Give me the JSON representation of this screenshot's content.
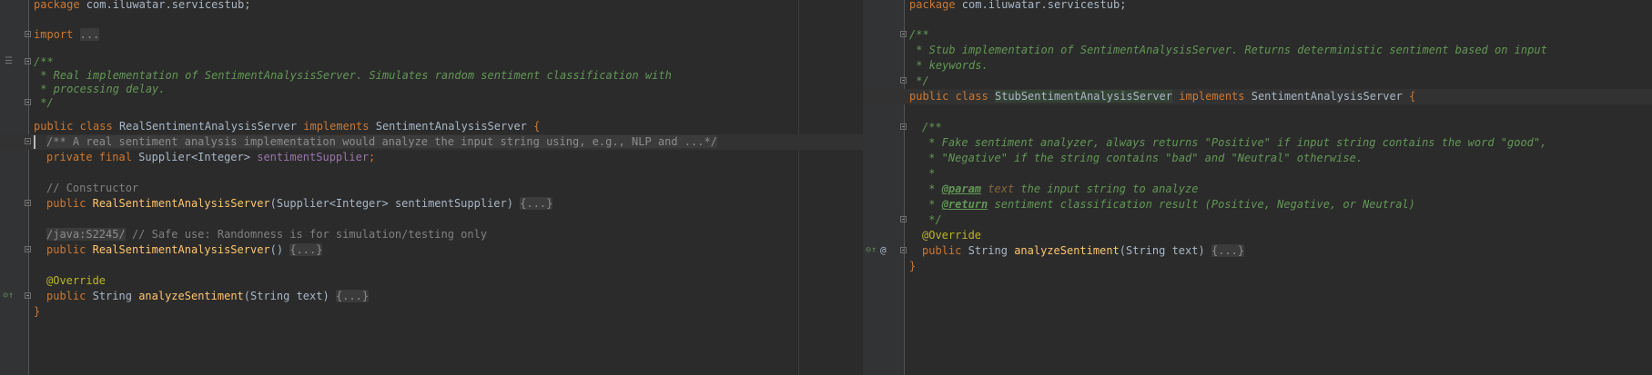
{
  "left_editor": {
    "package_kw": "package",
    "package_name": " com.iluwatar.servicestub;",
    "import_kw": "import",
    "import_folded": "...",
    "javadoc": [
      "/**",
      " * Real implementation of SentimentAnalysisServer. Simulates random sentiment classification with",
      " * processing delay.",
      " */"
    ],
    "class_modifiers": "public class",
    "class_name": "RealSentimentAnalysisServer",
    "implements_kw": "implements",
    "interface_name": "SentimentAnalysisServer",
    "open_brace": "{",
    "folded_comment": "/** A real sentiment analysis implementation would analyze the input string using, e.g., NLP and ...*/",
    "field_modifiers": "private final",
    "field_type": "Supplier<Integer>",
    "field_name": "sentimentSupplier",
    "field_end": ";",
    "ctor_comment": "// Constructor",
    "public_kw": "public",
    "ctor1_name": "RealSentimentAnalysisServer",
    "ctor1_params": "(Supplier<Integer> sentimentSupplier)",
    "folded_body": "{...}",
    "suppress_tag": "/java:S2245/",
    "suppress_comment": "// Safe use: Randomness is for simulation/testing only",
    "ctor2_name": "RealSentimentAnalysisServer",
    "ctor2_params": "()",
    "override_annotation": "@Override",
    "method_return": "String",
    "method_name": "analyzeSentiment",
    "method_params": "(String text)",
    "close_brace": "}"
  },
  "right_editor": {
    "package_kw": "package",
    "package_name": " com.iluwatar.servicestub;",
    "class_javadoc": [
      "/**",
      " * Stub implementation of SentimentAnalysisServer. Returns deterministic sentiment based on input",
      " * keywords.",
      " */"
    ],
    "class_modifiers": "public class",
    "class_name": "StubSentimentAnalysisServer",
    "implements_kw": "implements",
    "interface_name": "SentimentAnalysisServer",
    "open_brace": "{",
    "method_javadoc": [
      "/**",
      " * Fake sentiment analyzer, always returns \"Positive\" if input string contains the word \"good\",",
      " * \"Negative\" if the string contains \"bad\" and \"Neutral\" otherwise.",
      " *"
    ],
    "param_prefix": " * ",
    "param_tag": "@param",
    "param_name": " text",
    "param_desc": " the input string to analyze",
    "return_prefix": " * ",
    "return_tag": "@return",
    "return_desc": " sentiment classification result (Positive, Negative, or Neutral)",
    "javadoc_end": " */",
    "override_annotation": "@Override",
    "public_kw": "public",
    "method_return": "String",
    "method_name": "analyzeSentiment",
    "method_params": "(String text)",
    "folded_body": "{...}",
    "close_brace": "}"
  },
  "gutter_icons": {
    "override": "override-icon",
    "annotation": "at-icon",
    "render_doc": "lines-icon"
  },
  "colors": {
    "background": "#2b2b2b",
    "gutter": "#313335",
    "keyword": "#cc7832",
    "doc_comment": "#629755",
    "method": "#ffc66d",
    "field": "#9876aa",
    "annotation": "#bbb529",
    "default_text": "#a9b7c6"
  }
}
